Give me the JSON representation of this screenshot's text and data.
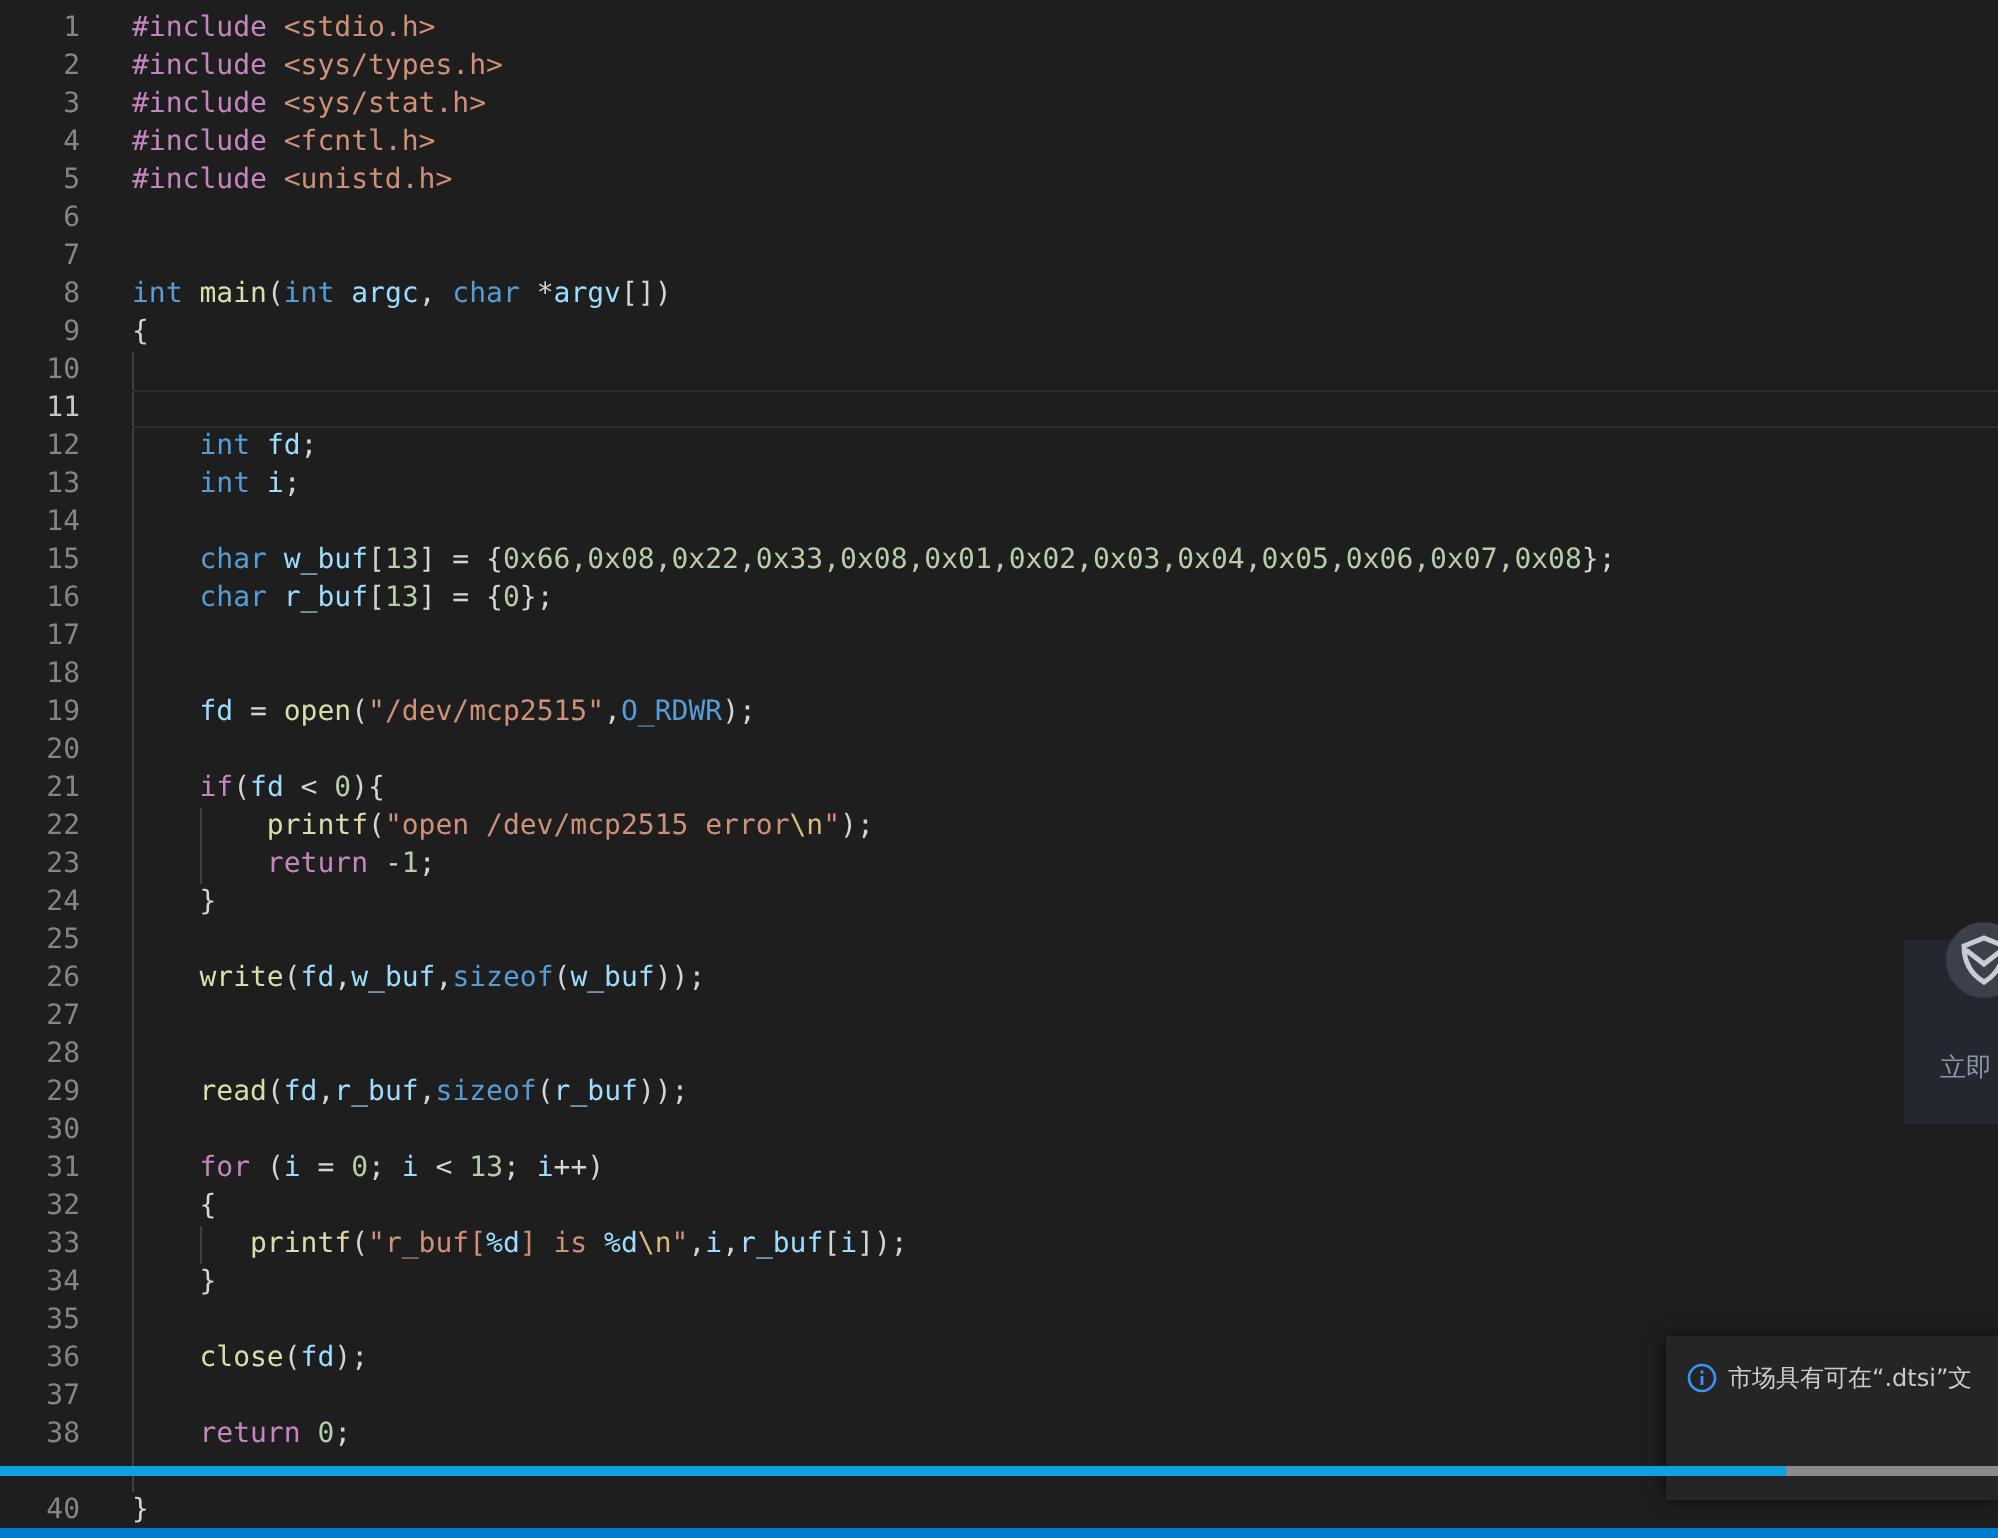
{
  "editor": {
    "lines": [
      {
        "number": "1",
        "current": false,
        "tokens": [
          {
            "kind": "directive",
            "text": "#include "
          },
          {
            "kind": "string",
            "text": "<stdio.h>"
          }
        ]
      },
      {
        "number": "2",
        "current": false,
        "tokens": [
          {
            "kind": "directive",
            "text": "#include "
          },
          {
            "kind": "string",
            "text": "<sys/types.h>"
          }
        ]
      },
      {
        "number": "3",
        "current": false,
        "tokens": [
          {
            "kind": "directive",
            "text": "#include "
          },
          {
            "kind": "string",
            "text": "<sys/stat.h>"
          }
        ]
      },
      {
        "number": "4",
        "current": false,
        "tokens": [
          {
            "kind": "directive",
            "text": "#include "
          },
          {
            "kind": "string",
            "text": "<fcntl.h>"
          }
        ]
      },
      {
        "number": "5",
        "current": false,
        "tokens": [
          {
            "kind": "directive",
            "text": "#include "
          },
          {
            "kind": "string",
            "text": "<unistd.h>"
          }
        ]
      },
      {
        "number": "6",
        "current": false
      },
      {
        "number": "7",
        "current": false
      },
      {
        "number": "8",
        "current": false,
        "tokens": [
          {
            "kind": "keyword",
            "text": "int "
          },
          {
            "kind": "function",
            "text": "main"
          },
          {
            "kind": "plain",
            "text": "("
          },
          {
            "kind": "keyword",
            "text": "int "
          },
          {
            "kind": "variable",
            "text": "argc"
          },
          {
            "kind": "plain",
            "text": ", "
          },
          {
            "kind": "keyword",
            "text": "char "
          },
          {
            "kind": "plain",
            "text": "*"
          },
          {
            "kind": "variable",
            "text": "argv"
          },
          {
            "kind": "plain",
            "text": "[])"
          }
        ]
      },
      {
        "number": "9",
        "current": false,
        "tokens": [
          {
            "kind": "plain",
            "text": "{"
          }
        ]
      },
      {
        "number": "10",
        "current": false
      },
      {
        "number": "11",
        "current": true
      },
      {
        "number": "12",
        "current": false,
        "tokens": [
          {
            "kind": "keyword",
            "text": "    int "
          },
          {
            "kind": "variable",
            "text": "fd"
          },
          {
            "kind": "plain",
            "text": ";"
          }
        ]
      },
      {
        "number": "13",
        "current": false,
        "tokens": [
          {
            "kind": "keyword",
            "text": "    int "
          },
          {
            "kind": "variable",
            "text": "i"
          },
          {
            "kind": "plain",
            "text": ";"
          }
        ]
      },
      {
        "number": "14",
        "current": false
      },
      {
        "number": "15",
        "current": false,
        "tokens": [
          {
            "kind": "keyword",
            "text": "    char "
          },
          {
            "kind": "variable",
            "text": "w_buf"
          },
          {
            "kind": "plain",
            "text": "["
          },
          {
            "kind": "number",
            "text": "13"
          },
          {
            "kind": "plain",
            "text": "] = {"
          },
          {
            "kind": "number",
            "text": "0x66,0x08,0x22,0x33,0x08,0x01,0x02,0x03,0x04,0x05,0x06,0x07,0x08"
          },
          {
            "kind": "plain",
            "text": "};"
          }
        ]
      },
      {
        "number": "16",
        "current": false,
        "tokens": [
          {
            "kind": "keyword",
            "text": "    char "
          },
          {
            "kind": "variable",
            "text": "r_buf"
          },
          {
            "kind": "plain",
            "text": "["
          },
          {
            "kind": "number",
            "text": "13"
          },
          {
            "kind": "plain",
            "text": "] = {"
          },
          {
            "kind": "number",
            "text": "0"
          },
          {
            "kind": "plain",
            "text": "};"
          }
        ]
      },
      {
        "number": "17",
        "current": false
      },
      {
        "number": "18",
        "current": false
      },
      {
        "number": "19",
        "current": false,
        "tokens": [
          {
            "kind": "variable",
            "text": "    fd"
          },
          {
            "kind": "plain",
            "text": " = "
          },
          {
            "kind": "function",
            "text": "open"
          },
          {
            "kind": "plain",
            "text": "("
          },
          {
            "kind": "string",
            "text": "\"/dev/mcp2515\""
          },
          {
            "kind": "plain",
            "text": ","
          },
          {
            "kind": "macro",
            "text": "O_RDWR"
          },
          {
            "kind": "plain",
            "text": ");"
          }
        ]
      },
      {
        "number": "20",
        "current": false
      },
      {
        "number": "21",
        "current": false,
        "tokens": [
          {
            "kind": "control",
            "text": "    if"
          },
          {
            "kind": "plain",
            "text": "("
          },
          {
            "kind": "variable",
            "text": "fd"
          },
          {
            "kind": "plain",
            "text": " < "
          },
          {
            "kind": "number",
            "text": "0"
          },
          {
            "kind": "plain",
            "text": "){"
          }
        ]
      },
      {
        "number": "22",
        "current": false,
        "tokens": [
          {
            "kind": "function",
            "text": "        printf"
          },
          {
            "kind": "plain",
            "text": "("
          },
          {
            "kind": "string",
            "text": "\"open /dev/mcp2515 error"
          },
          {
            "kind": "escape",
            "text": "\\n"
          },
          {
            "kind": "string",
            "text": "\""
          },
          {
            "kind": "plain",
            "text": ");"
          }
        ]
      },
      {
        "number": "23",
        "current": false,
        "tokens": [
          {
            "kind": "control",
            "text": "        return "
          },
          {
            "kind": "plain",
            "text": "-"
          },
          {
            "kind": "number",
            "text": "1"
          },
          {
            "kind": "plain",
            "text": ";"
          }
        ]
      },
      {
        "number": "24",
        "current": false,
        "tokens": [
          {
            "kind": "plain",
            "text": "    }"
          }
        ]
      },
      {
        "number": "25",
        "current": false
      },
      {
        "number": "26",
        "current": false,
        "tokens": [
          {
            "kind": "function",
            "text": "    write"
          },
          {
            "kind": "plain",
            "text": "("
          },
          {
            "kind": "variable",
            "text": "fd"
          },
          {
            "kind": "plain",
            "text": ","
          },
          {
            "kind": "variable",
            "text": "w_buf"
          },
          {
            "kind": "plain",
            "text": ","
          },
          {
            "kind": "keyword",
            "text": "sizeof"
          },
          {
            "kind": "plain",
            "text": "("
          },
          {
            "kind": "variable",
            "text": "w_buf"
          },
          {
            "kind": "plain",
            "text": "));"
          }
        ]
      },
      {
        "number": "27",
        "current": false
      },
      {
        "number": "28",
        "current": false
      },
      {
        "number": "29",
        "current": false,
        "tokens": [
          {
            "kind": "function",
            "text": "    read"
          },
          {
            "kind": "plain",
            "text": "("
          },
          {
            "kind": "variable",
            "text": "fd"
          },
          {
            "kind": "plain",
            "text": ","
          },
          {
            "kind": "variable",
            "text": "r_buf"
          },
          {
            "kind": "plain",
            "text": ","
          },
          {
            "kind": "keyword",
            "text": "sizeof"
          },
          {
            "kind": "plain",
            "text": "("
          },
          {
            "kind": "variable",
            "text": "r_buf"
          },
          {
            "kind": "plain",
            "text": "));"
          }
        ]
      },
      {
        "number": "30",
        "current": false
      },
      {
        "number": "31",
        "current": false,
        "tokens": [
          {
            "kind": "control",
            "text": "    for"
          },
          {
            "kind": "plain",
            "text": " ("
          },
          {
            "kind": "variable",
            "text": "i"
          },
          {
            "kind": "plain",
            "text": " = "
          },
          {
            "kind": "number",
            "text": "0"
          },
          {
            "kind": "plain",
            "text": "; "
          },
          {
            "kind": "variable",
            "text": "i"
          },
          {
            "kind": "plain",
            "text": " < "
          },
          {
            "kind": "number",
            "text": "13"
          },
          {
            "kind": "plain",
            "text": "; "
          },
          {
            "kind": "variable",
            "text": "i"
          },
          {
            "kind": "plain",
            "text": "++)"
          }
        ]
      },
      {
        "number": "32",
        "current": false,
        "tokens": [
          {
            "kind": "plain",
            "text": "    {"
          }
        ]
      },
      {
        "number": "33",
        "current": false,
        "tokens": [
          {
            "kind": "function",
            "text": "       printf"
          },
          {
            "kind": "plain",
            "text": "("
          },
          {
            "kind": "string",
            "text": "\"r_buf["
          },
          {
            "kind": "format",
            "text": "%d"
          },
          {
            "kind": "string",
            "text": "] is "
          },
          {
            "kind": "format",
            "text": "%d"
          },
          {
            "kind": "escape",
            "text": "\\n"
          },
          {
            "kind": "string",
            "text": "\""
          },
          {
            "kind": "plain",
            "text": ","
          },
          {
            "kind": "variable",
            "text": "i"
          },
          {
            "kind": "plain",
            "text": ","
          },
          {
            "kind": "variable",
            "text": "r_buf"
          },
          {
            "kind": "plain",
            "text": "["
          },
          {
            "kind": "variable",
            "text": "i"
          },
          {
            "kind": "plain",
            "text": "]);"
          }
        ]
      },
      {
        "number": "34",
        "current": false,
        "tokens": [
          {
            "kind": "plain",
            "text": "    }"
          }
        ]
      },
      {
        "number": "35",
        "current": false
      },
      {
        "number": "36",
        "current": false,
        "tokens": [
          {
            "kind": "function",
            "text": "    close"
          },
          {
            "kind": "plain",
            "text": "("
          },
          {
            "kind": "variable",
            "text": "fd"
          },
          {
            "kind": "plain",
            "text": ");"
          }
        ]
      },
      {
        "number": "37",
        "current": false
      },
      {
        "number": "38",
        "current": false,
        "tokens": [
          {
            "kind": "control",
            "text": "    return "
          },
          {
            "kind": "number",
            "text": "0"
          },
          {
            "kind": "plain",
            "text": ";"
          }
        ]
      },
      {
        "current": false
      },
      {
        "number": "40",
        "current": false,
        "tokens": [
          {
            "kind": "plain",
            "text": "}"
          }
        ]
      }
    ]
  },
  "side_widget": {
    "label": "立即"
  },
  "notification": {
    "message": "市场具有可在“.dtsi”文"
  },
  "progress": {
    "level": 0.894
  }
}
